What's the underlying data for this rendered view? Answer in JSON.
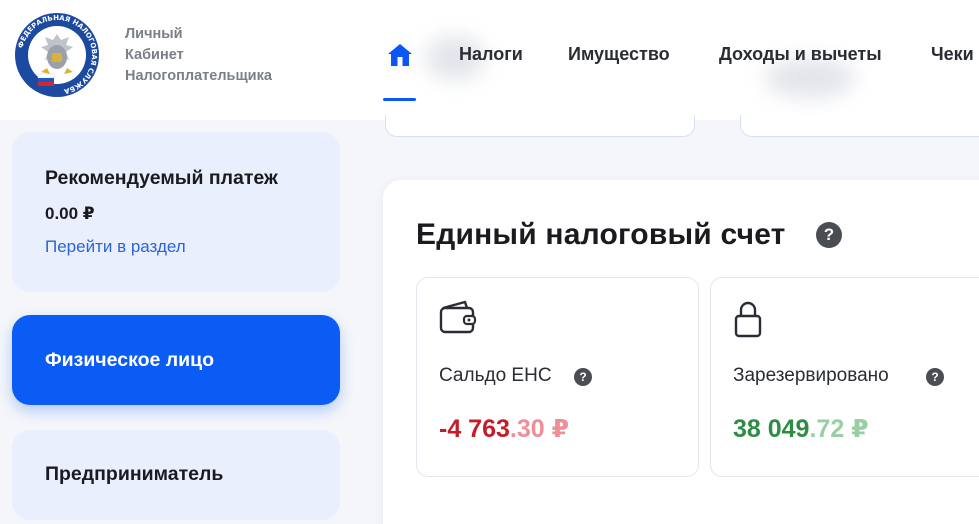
{
  "brand": {
    "line1": "Личный",
    "line2": "Кабинет",
    "line3": "Налогоплательщика",
    "emblem_text": "ФЕДЕРАЛЬНАЯ НАЛОГОВАЯ СЛУЖБА"
  },
  "nav": {
    "home_icon": "home-icon",
    "items": [
      "Налоги",
      "Имущество",
      "Доходы и вычеты",
      "Чеки"
    ],
    "active_color": "#0b57f5"
  },
  "sidebar": {
    "payment": {
      "title": "Рекомендуемый платеж",
      "amount": "0.00 ₽",
      "link": "Перейти в раздел"
    },
    "person": {
      "label": "Физическое лицо"
    },
    "entrepreneur": {
      "label": "Предприниматель"
    }
  },
  "ens": {
    "title": "Единый налоговый счет",
    "help": "?",
    "saldo": {
      "icon": "wallet-icon",
      "label": "Сальдо ЕНС",
      "value_int": "-4 763",
      "value_frac": ".30 ₽",
      "color": "#c41d2a"
    },
    "reserved": {
      "icon": "lock-icon",
      "label": "Зарезервировано",
      "value_int": "38 049",
      "value_frac": ".72 ₽",
      "color": "#2f8c45"
    }
  }
}
